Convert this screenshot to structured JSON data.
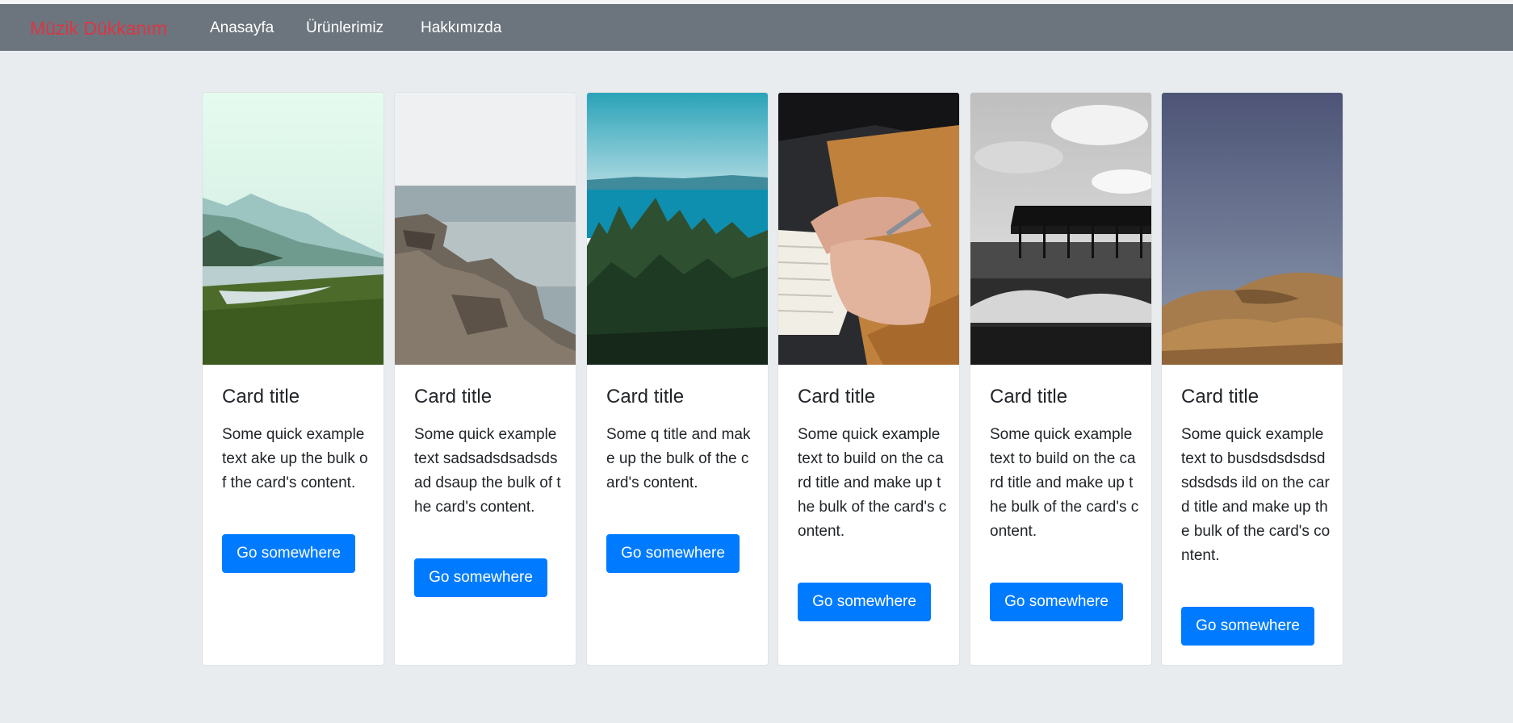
{
  "navbar": {
    "brand": "Müzik Dükkanım",
    "links": [
      "Anasayfa",
      "Ürünlerimiz",
      "Hakkımızda"
    ]
  },
  "cards": [
    {
      "title": "Card title",
      "text": "Some quick example text ake up the bulk of the card's content.",
      "button": "Go somewhere",
      "image": "misty-lake-forest"
    },
    {
      "title": "Card title",
      "text": "Some quick example text sadsadsdsadsdsad dsaup the bulk of the card's content.",
      "button": "Go somewhere",
      "image": "rocky-coast-sea"
    },
    {
      "title": "Card title",
      "text": "Some q title and make up the bulk of the card's content.",
      "button": "Go somewhere",
      "image": "forest-ocean-view"
    },
    {
      "title": "Card title",
      "text": "Some quick example text to build on the card title and make up the bulk of the card's content.",
      "button": "Go somewhere",
      "image": "hands-writing-notebook"
    },
    {
      "title": "Card title",
      "text": "Some quick example text to build on the card title and make up the bulk of the card's content.",
      "button": "Go somewhere",
      "image": "pier-black-white"
    },
    {
      "title": "Card title",
      "text": "Some quick example text to busdsdsdsdsdsdsdsds ild on the card title and make up the bulk of the card's content.",
      "button": "Go somewhere",
      "image": "desert-hills"
    }
  ],
  "colors": {
    "navbar": "#6c757d",
    "brand": "#dc3545",
    "button": "#007bff",
    "page": "#e9ecef"
  }
}
